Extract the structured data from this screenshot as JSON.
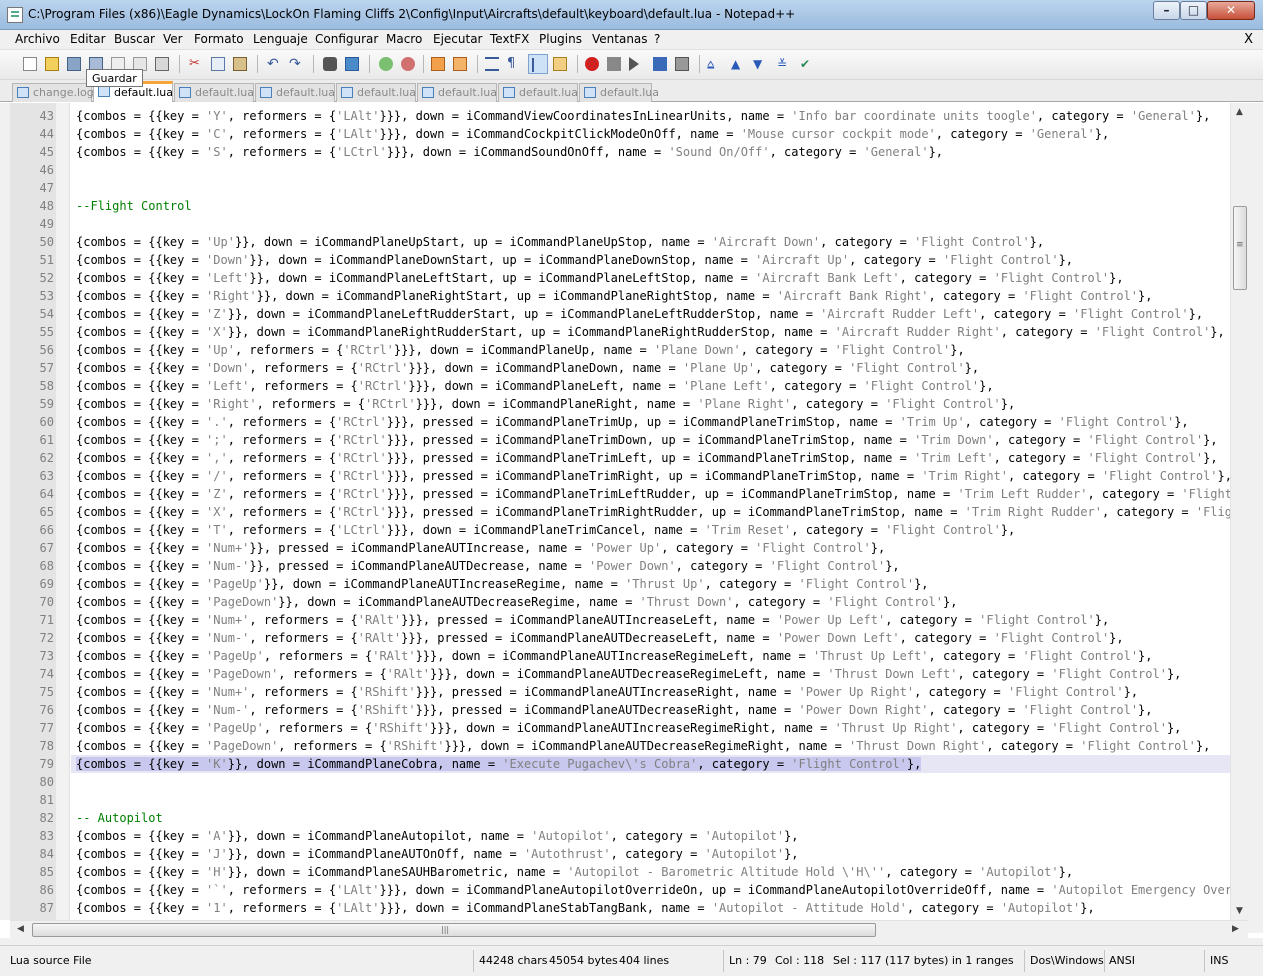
{
  "window": {
    "title": "C:\\Program Files (x86)\\Eagle Dynamics\\LockOn Flaming Cliffs 2\\Config\\Input\\Aircrafts\\default\\keyboard\\default.lua - Notepad++",
    "min_glyph": "–",
    "max_glyph": "□",
    "close_glyph": "✕"
  },
  "menu": {
    "items": [
      "Archivo",
      "Editar",
      "Buscar",
      "Ver",
      "Formato",
      "Lenguaje",
      "Configurar",
      "Macro",
      "Ejecutar",
      "TextFX",
      "Plugins",
      "Ventanas",
      "?"
    ],
    "close_label": "X"
  },
  "toolbar": {
    "tooltip": "Guardar",
    "icons": [
      "new-file-icon",
      "open-file-icon",
      "save-icon",
      "save-all-icon",
      "close-file-icon",
      "close-all-icon",
      "print-icon",
      "cut-icon",
      "copy-icon",
      "paste-icon",
      "undo-icon",
      "redo-icon",
      "find-icon",
      "replace-icon",
      "zoom-in-icon",
      "zoom-out-icon",
      "sync-vertical-icon",
      "sync-horizontal-icon",
      "word-wrap-icon",
      "show-all-chars-icon",
      "indent-guide-icon",
      "user-lang-icon",
      "record-macro-icon",
      "stop-record-icon",
      "play-macro-icon",
      "run-macro-multiple-icon",
      "save-macro-icon",
      "textfx-collapse-icon",
      "textfx-up-icon",
      "textfx-down-icon",
      "textfx-filter-icon",
      "textfx-spellcheck-icon"
    ]
  },
  "tabs": [
    {
      "label": "change.log",
      "active": false
    },
    {
      "label": "default.lua",
      "active": true
    },
    {
      "label": "default.lua",
      "active": false
    },
    {
      "label": "default.lua",
      "active": false
    },
    {
      "label": "default.lua",
      "active": false
    },
    {
      "label": "default.lua",
      "active": false
    },
    {
      "label": "default.lua",
      "active": false
    },
    {
      "label": "default.lua",
      "active": false
    }
  ],
  "editor": {
    "selected_line": 79,
    "lines": [
      {
        "n": "43",
        "t": "{combos = {{key = 'Y', reformers = {'LAlt'}}}, down = iCommandViewCoordinatesInLinearUnits, name = 'Info bar coordinate units toogle', category = 'General'},"
      },
      {
        "n": "44",
        "t": "{combos = {{key = 'C', reformers = {'LAlt'}}}, down = iCommandCockpitClickModeOnOff, name = 'Mouse cursor cockpit mode', category = 'General'},"
      },
      {
        "n": "45",
        "t": "{combos = {{key = 'S', reformers = {'LCtrl'}}}, down = iCommandSoundOnOff, name = 'Sound On/Off', category = 'General'},"
      },
      {
        "n": "46",
        "t": ""
      },
      {
        "n": "47",
        "t": ""
      },
      {
        "n": "48",
        "t": "--Flight Control"
      },
      {
        "n": "49",
        "t": ""
      },
      {
        "n": "50",
        "t": "{combos = {{key = 'Up'}}, down = iCommandPlaneUpStart, up = iCommandPlaneUpStop, name = 'Aircraft Down', category = 'Flight Control'},"
      },
      {
        "n": "51",
        "t": "{combos = {{key = 'Down'}}, down = iCommandPlaneDownStart, up = iCommandPlaneDownStop, name = 'Aircraft Up', category = 'Flight Control'},"
      },
      {
        "n": "52",
        "t": "{combos = {{key = 'Left'}}, down = iCommandPlaneLeftStart, up = iCommandPlaneLeftStop, name = 'Aircraft Bank Left', category = 'Flight Control'},"
      },
      {
        "n": "53",
        "t": "{combos = {{key = 'Right'}}, down = iCommandPlaneRightStart, up = iCommandPlaneRightStop, name = 'Aircraft Bank Right', category = 'Flight Control'},"
      },
      {
        "n": "54",
        "t": "{combos = {{key = 'Z'}}, down = iCommandPlaneLeftRudderStart, up = iCommandPlaneLeftRudderStop, name = 'Aircraft Rudder Left', category = 'Flight Control'},"
      },
      {
        "n": "55",
        "t": "{combos = {{key = 'X'}}, down = iCommandPlaneRightRudderStart, up = iCommandPlaneRightRudderStop, name = 'Aircraft Rudder Right', category = 'Flight Control'},"
      },
      {
        "n": "56",
        "t": "{combos = {{key = 'Up', reformers = {'RCtrl'}}}, down = iCommandPlaneUp, name = 'Plane Down', category = 'Flight Control'},"
      },
      {
        "n": "57",
        "t": "{combos = {{key = 'Down', reformers = {'RCtrl'}}}, down = iCommandPlaneDown, name = 'Plane Up', category = 'Flight Control'},"
      },
      {
        "n": "58",
        "t": "{combos = {{key = 'Left', reformers = {'RCtrl'}}}, down = iCommandPlaneLeft, name = 'Plane Left', category = 'Flight Control'},"
      },
      {
        "n": "59",
        "t": "{combos = {{key = 'Right', reformers = {'RCtrl'}}}, down = iCommandPlaneRight, name = 'Plane Right', category = 'Flight Control'},"
      },
      {
        "n": "60",
        "t": "{combos = {{key = '.', reformers = {'RCtrl'}}}, pressed = iCommandPlaneTrimUp, up = iCommandPlaneTrimStop, name = 'Trim Up', category = 'Flight Control'},"
      },
      {
        "n": "61",
        "t": "{combos = {{key = ';', reformers = {'RCtrl'}}}, pressed = iCommandPlaneTrimDown, up = iCommandPlaneTrimStop, name = 'Trim Down', category = 'Flight Control'},"
      },
      {
        "n": "62",
        "t": "{combos = {{key = ',', reformers = {'RCtrl'}}}, pressed = iCommandPlaneTrimLeft, up = iCommandPlaneTrimStop, name = 'Trim Left', category = 'Flight Control'},"
      },
      {
        "n": "63",
        "t": "{combos = {{key = '/', reformers = {'RCtrl'}}}, pressed = iCommandPlaneTrimRight, up = iCommandPlaneTrimStop, name = 'Trim Right', category = 'Flight Control'},"
      },
      {
        "n": "64",
        "t": "{combos = {{key = 'Z', reformers = {'RCtrl'}}}, pressed = iCommandPlaneTrimLeftRudder, up = iCommandPlaneTrimStop, name = 'Trim Left Rudder', category = 'Flight Control'},"
      },
      {
        "n": "65",
        "t": "{combos = {{key = 'X', reformers = {'RCtrl'}}}, pressed = iCommandPlaneTrimRightRudder, up = iCommandPlaneTrimStop, name = 'Trim Right Rudder', category = 'Flight Control'},"
      },
      {
        "n": "66",
        "t": "{combos = {{key = 'T', reformers = {'LCtrl'}}}, down = iCommandPlaneTrimCancel, name = 'Trim Reset', category = 'Flight Control'},"
      },
      {
        "n": "67",
        "t": "{combos = {{key = 'Num+'}}, pressed = iCommandPlaneAUTIncrease, name = 'Power Up', category = 'Flight Control'},"
      },
      {
        "n": "68",
        "t": "{combos = {{key = 'Num-'}}, pressed = iCommandPlaneAUTDecrease, name = 'Power Down', category = 'Flight Control'},"
      },
      {
        "n": "69",
        "t": "{combos = {{key = 'PageUp'}}, down = iCommandPlaneAUTIncreaseRegime, name = 'Thrust Up', category = 'Flight Control'},"
      },
      {
        "n": "70",
        "t": "{combos = {{key = 'PageDown'}}, down = iCommandPlaneAUTDecreaseRegime, name = 'Thrust Down', category = 'Flight Control'},"
      },
      {
        "n": "71",
        "t": "{combos = {{key = 'Num+', reformers = {'RAlt'}}}, pressed = iCommandPlaneAUTIncreaseLeft, name = 'Power Up Left', category = 'Flight Control'},"
      },
      {
        "n": "72",
        "t": "{combos = {{key = 'Num-', reformers = {'RAlt'}}}, pressed = iCommandPlaneAUTDecreaseLeft, name = 'Power Down Left', category = 'Flight Control'},"
      },
      {
        "n": "73",
        "t": "{combos = {{key = 'PageUp', reformers = {'RAlt'}}}, down = iCommandPlaneAUTIncreaseRegimeLeft, name = 'Thrust Up Left', category = 'Flight Control'},"
      },
      {
        "n": "74",
        "t": "{combos = {{key = 'PageDown', reformers = {'RAlt'}}}, down = iCommandPlaneAUTDecreaseRegimeLeft, name = 'Thrust Down Left', category = 'Flight Control'},"
      },
      {
        "n": "75",
        "t": "{combos = {{key = 'Num+', reformers = {'RShift'}}}, pressed = iCommandPlaneAUTIncreaseRight, name = 'Power Up Right', category = 'Flight Control'},"
      },
      {
        "n": "76",
        "t": "{combos = {{key = 'Num-', reformers = {'RShift'}}}, pressed = iCommandPlaneAUTDecreaseRight, name = 'Power Down Right', category = 'Flight Control'},"
      },
      {
        "n": "77",
        "t": "{combos = {{key = 'PageUp', reformers = {'RShift'}}}, down = iCommandPlaneAUTIncreaseRegimeRight, name = 'Thrust Up Right', category = 'Flight Control'},"
      },
      {
        "n": "78",
        "t": "{combos = {{key = 'PageDown', reformers = {'RShift'}}}, down = iCommandPlaneAUTDecreaseRegimeRight, name = 'Thrust Down Right', category = 'Flight Control'},"
      },
      {
        "n": "79",
        "t": "{combos = {{key = 'K'}}, down = iCommandPlaneCobra, name = 'Execute Pugachev\\'s Cobra', category = 'Flight Control'},"
      },
      {
        "n": "80",
        "t": ""
      },
      {
        "n": "81",
        "t": ""
      },
      {
        "n": "82",
        "t": "-- Autopilot"
      },
      {
        "n": "83",
        "t": "{combos = {{key = 'A'}}, down = iCommandPlaneAutopilot, name = 'Autopilot', category = 'Autopilot'},"
      },
      {
        "n": "84",
        "t": "{combos = {{key = 'J'}}, down = iCommandPlaneAUTOnOff, name = 'Autothrust', category = 'Autopilot'},"
      },
      {
        "n": "85",
        "t": "{combos = {{key = 'H'}}, down = iCommandPlaneSAUHBarometric, name = 'Autopilot - Barometric Altitude Hold \\'H\\'', category = 'Autopilot'},"
      },
      {
        "n": "86",
        "t": "{combos = {{key = '`', reformers = {'LAlt'}}}, down = iCommandPlaneAutopilotOverrideOn, up = iCommandPlaneAutopilotOverrideOff, name = 'Autopilot Emergency Override', category = 'Autopilot'},"
      },
      {
        "n": "87",
        "t": "{combos = {{key = '1', reformers = {'LAlt'}}}, down = iCommandPlaneStabTangBank, name = 'Autopilot - Attitude Hold', category = 'Autopilot'},"
      }
    ]
  },
  "scrollbars": {
    "vertical_grip": "≡",
    "horizontal_grip": "|||",
    "up_arrow": "▲",
    "down_arrow": "▼",
    "left_arrow": "◀",
    "right_arrow": "▶"
  },
  "statusbar": {
    "file_type": "Lua source File",
    "chars": "44248 chars",
    "bytes": "45054 bytes",
    "lines": "404 lines",
    "ln": "Ln : 79",
    "col": "Col : 118",
    "sel": "Sel : 117 (117 bytes) in 1 ranges",
    "eol": "Dos\\Windows",
    "encoding": "ANSI",
    "mode": "INS"
  },
  "colors": {
    "keyword": "#000000",
    "string": "#808080",
    "comment": "#008000",
    "selection_line": "#e6e6f4",
    "tab_accent": "#f7a53a"
  }
}
